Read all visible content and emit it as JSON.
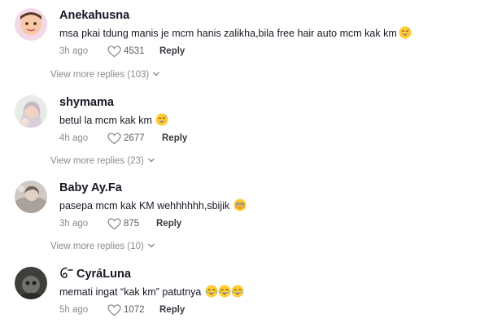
{
  "comments": [
    {
      "username": "Anekahusna",
      "text": "msa pkai tdung manis je mcm hanis zalikha,bila free hair auto mcm kak km",
      "emoji": "sweat-smile-emoji",
      "time": "3h ago",
      "likes": "4531",
      "reply_label": "Reply",
      "more_replies": "View more replies (103)"
    },
    {
      "username": "shymama",
      "text": "betul la mcm kak km",
      "emoji": "sweat-smile-emoji",
      "time": "4h ago",
      "likes": "2677",
      "reply_label": "Reply",
      "more_replies": "View more replies (23)"
    },
    {
      "username": "Baby Ay.Fa",
      "text": "pasepa mcm kak KM wehhhhhh,sbijik",
      "emoji": "flushed-face-emoji",
      "time": "3h ago",
      "likes": "875",
      "reply_label": "Reply",
      "more_replies": "View more replies (10)"
    },
    {
      "username": "CyráLuna",
      "text": "memati ingat “kak km” patutnya",
      "emoji": "tears-of-joy-emoji x3",
      "time": "5h ago",
      "likes": "1072",
      "reply_label": "Reply"
    }
  ],
  "icons": {
    "like": "heart-outline-icon",
    "expand": "chevron-down-icon",
    "live_badge": "live-badge-icon"
  },
  "colors": {
    "text": "#161823",
    "muted": "#8a8b91",
    "reply": "#3a3b42",
    "background": "#ffffff"
  }
}
